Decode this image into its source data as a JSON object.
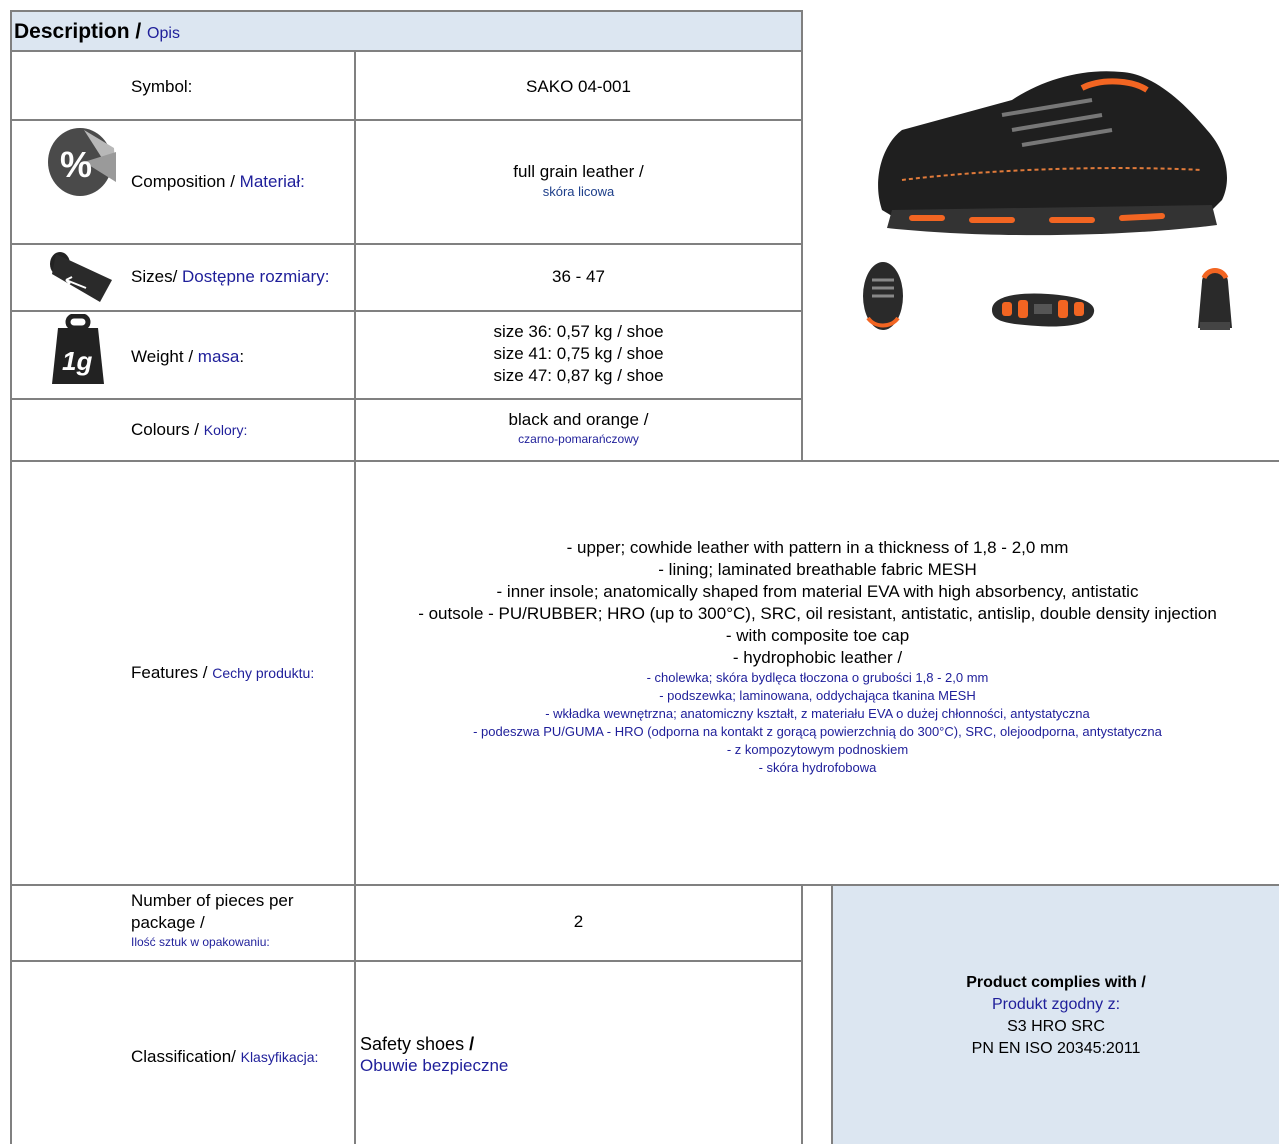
{
  "header": {
    "title_en": "Description /",
    "title_pl": "Opis"
  },
  "rows": {
    "symbol": {
      "label": "Symbol:",
      "value": "SAKO 04-001"
    },
    "composition": {
      "label_en": "Composition /",
      "label_pl": "Materiał",
      "label_colon": ":",
      "value_en": "full grain leather /",
      "value_pl": "skóra licowa"
    },
    "sizes": {
      "label_en": "Sizes/",
      "label_pl": "Dostępne rozmiary",
      "label_colon": ":",
      "value": "36 - 47"
    },
    "weight": {
      "label_en": "Weight /",
      "label_pl": "masa",
      "label_colon": ":",
      "values": [
        "size 36: 0,57 kg / shoe",
        "size 41: 0,75 kg / shoe",
        "size 47: 0,87 kg / shoe"
      ]
    },
    "colours": {
      "label_en": "Colours /",
      "label_pl": "Kolory",
      "label_colon": ":",
      "value_en": "black and orange /",
      "value_pl": "czarno-pomarańczowy"
    },
    "features": {
      "label_en": "Features /",
      "label_pl": "Cechy produktu",
      "label_colon": ":",
      "lines_en": [
        "- upper; cowhide leather with pattern in a thickness of 1,8 - 2,0 mm",
        "- lining; laminated breathable fabric MESH",
        "- inner insole; anatomically shaped from material EVA with high absorbency, antistatic",
        "- outsole - PU/RUBBER; HRO (up to 300°C), SRC, oil resistant, antistatic, antislip, double density injection",
        "- with composite toe cap",
        "- hydrophobic leather /"
      ],
      "lines_pl": [
        "- cholewka; skóra bydlęca tłoczona o grubości 1,8 - 2,0 mm",
        "- podszewka; laminowana, oddychająca tkanina MESH",
        "- wkładka wewnętrzna; anatomiczny kształt, z materiału EVA o dużej chłonności, antystatyczna",
        "- podeszwa PU/GUMA - HRO (odporna na kontakt z gorącą powierzchnią do 300°C), SRC, olejoodporna, antystatyczna",
        "- z kompozytowym podnoskiem",
        "- skóra hydrofobowa"
      ]
    },
    "pieces": {
      "label_line1": "Number of pieces per",
      "label_line2": "package /",
      "label_pl": "Ilość sztuk w opakowaniu:",
      "value": "2"
    },
    "classification": {
      "label_en": "Classification/",
      "label_pl": "Klasyfikacja",
      "label_colon": ":",
      "value_en": "Safety shoes",
      "value_slash": " /",
      "value_pl": "Obuwie bezpieczne"
    }
  },
  "compliance": {
    "title_en": "Product complies with /",
    "title_pl": "Produkt zgodny z:",
    "line1": "S3 HRO SRC",
    "line2": "PN EN ISO 20345:2011"
  },
  "icons": [
    "percent-pie-icon",
    "tape-roll-icon",
    "weight-1g-icon"
  ],
  "colors": {
    "header_bg": "#dce6f1",
    "compliance_bg": "#dce6f1",
    "border": "#808080",
    "blue_text": "#1f1f9a",
    "orange": "#f26522"
  }
}
